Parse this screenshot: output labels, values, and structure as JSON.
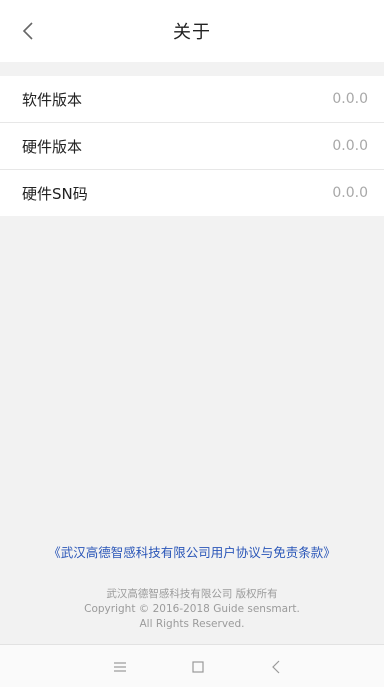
{
  "header": {
    "title": "关于",
    "back_icon": "chevron-left-icon"
  },
  "info_rows": [
    {
      "label": "软件版本",
      "value": "0.0.0"
    },
    {
      "label": "硬件版本",
      "value": "0.0.0"
    },
    {
      "label": "硬件SN码",
      "value": "0.0.0"
    }
  ],
  "footer": {
    "agreement_link": "《武汉高德智感科技有限公司用户协议与免责条款》",
    "company_line": "武汉高德智感科技有限公司 版权所有",
    "copyright_line": "Copyright © 2016-2018 Guide sensmart.",
    "rights_line": "All Rights Reserved."
  },
  "navbar": {
    "menu_icon": "menu-icon",
    "home_icon": "square-home-icon",
    "back_icon": "back-icon"
  },
  "colors": {
    "background": "#f2f2f2",
    "link": "#2a56b8",
    "muted": "#9b9b9b"
  }
}
